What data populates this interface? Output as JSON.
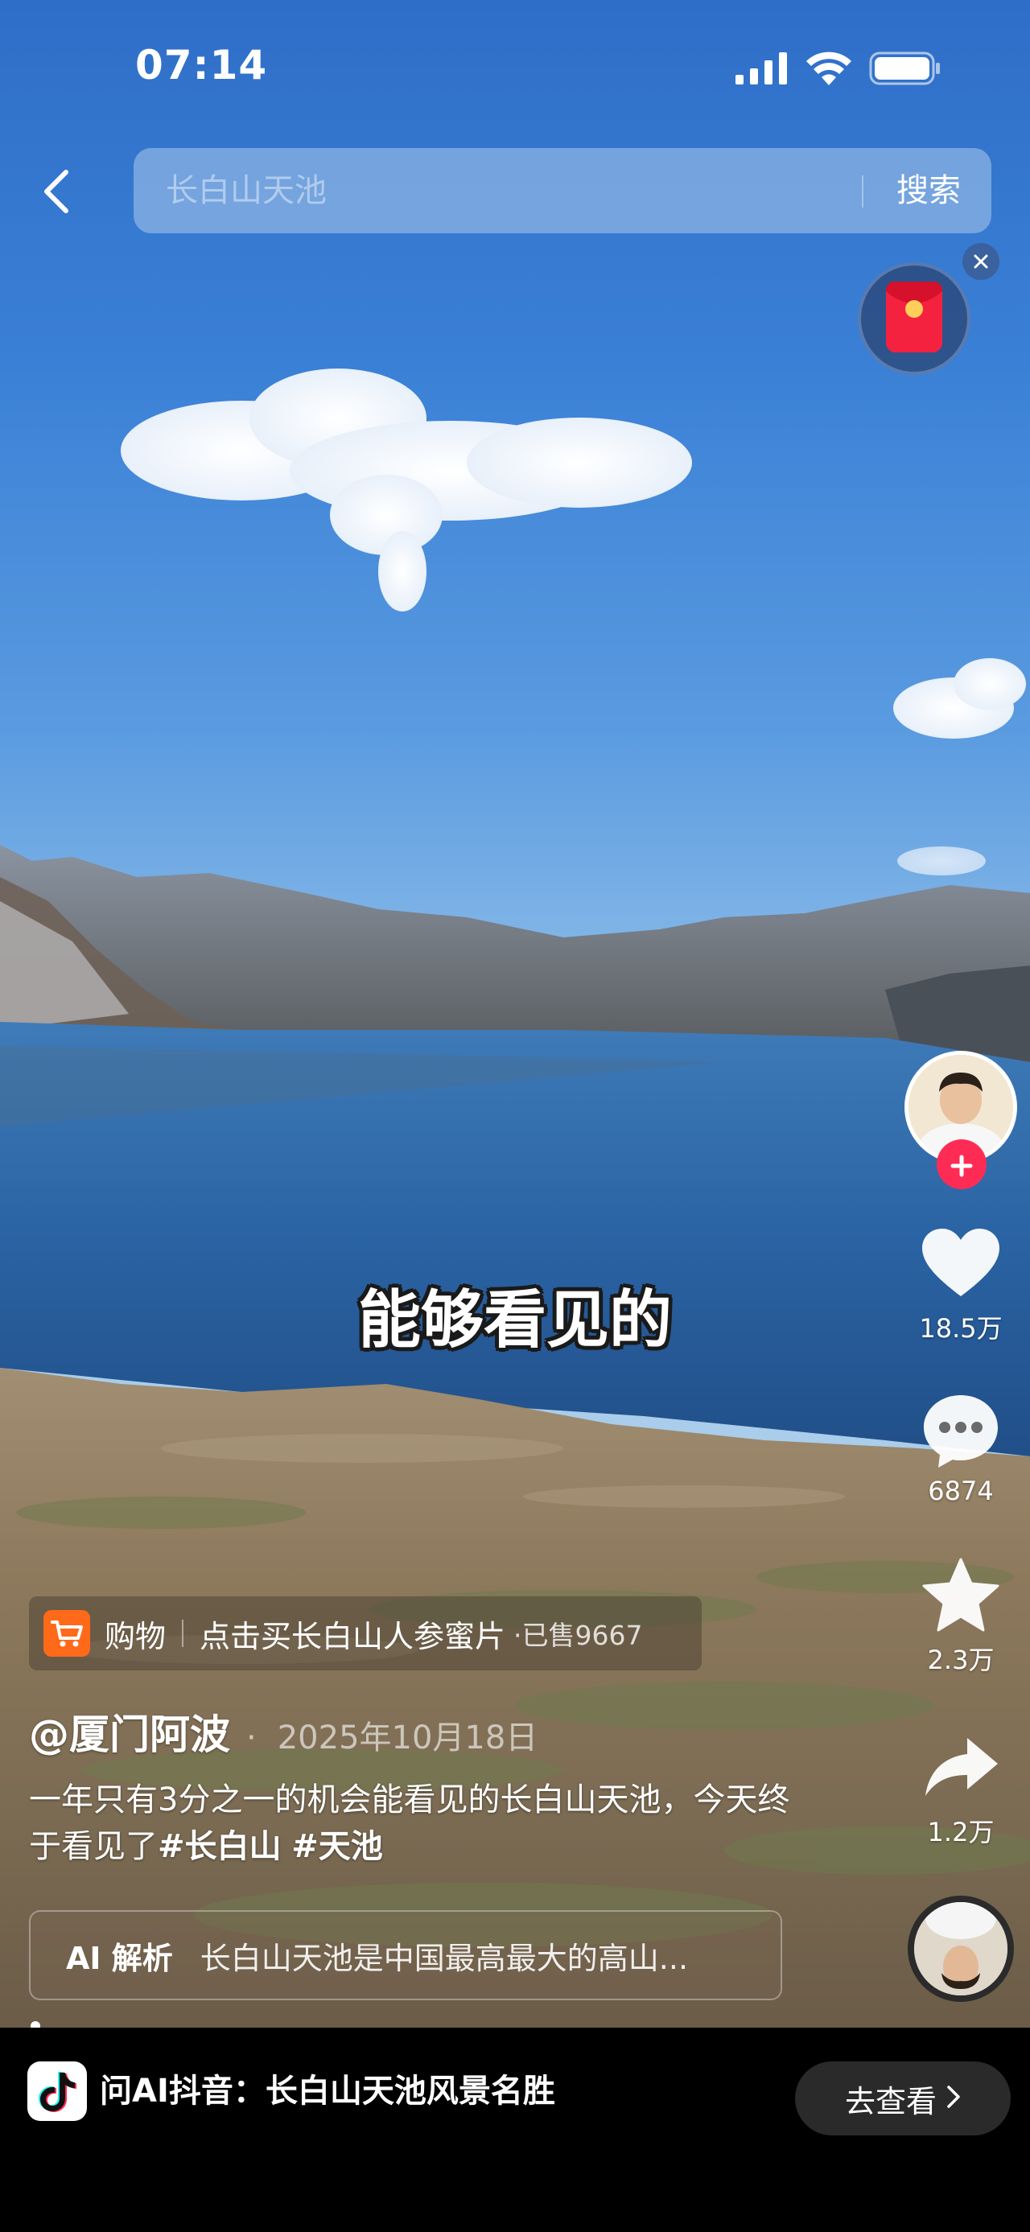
{
  "status_bar": {
    "time": "07:14"
  },
  "search": {
    "placeholder": "长白山天池",
    "button_label": "搜索"
  },
  "subtitle": "能够看见的",
  "actions": {
    "like_count": "18.5万",
    "comment_count": "6874",
    "favorite_count": "2.3万",
    "share_count": "1.2万"
  },
  "shop": {
    "label": "购物",
    "text": "点击买长白山人参蜜片",
    "sold": "·已售9667"
  },
  "author": {
    "name": "@厦门阿波",
    "separator": "·",
    "date": "2025年10月18日"
  },
  "description": {
    "text": "一年只有3分之一的机会能看见的长白山天池，今天终于看见了",
    "hashtags": [
      "#长白山",
      "#天池"
    ]
  },
  "ai_summary": {
    "label": "AI 解析",
    "text": "长白山天池是中国最高最大的高山..."
  },
  "bottom_bar": {
    "ask_text": "问AI抖音：长白山天池风景名胜",
    "go_label": "去查看"
  },
  "colors": {
    "accent_red": "#fe2c55",
    "shop_orange": "#ff6a1a",
    "sky_blue": "#3a80d6"
  }
}
